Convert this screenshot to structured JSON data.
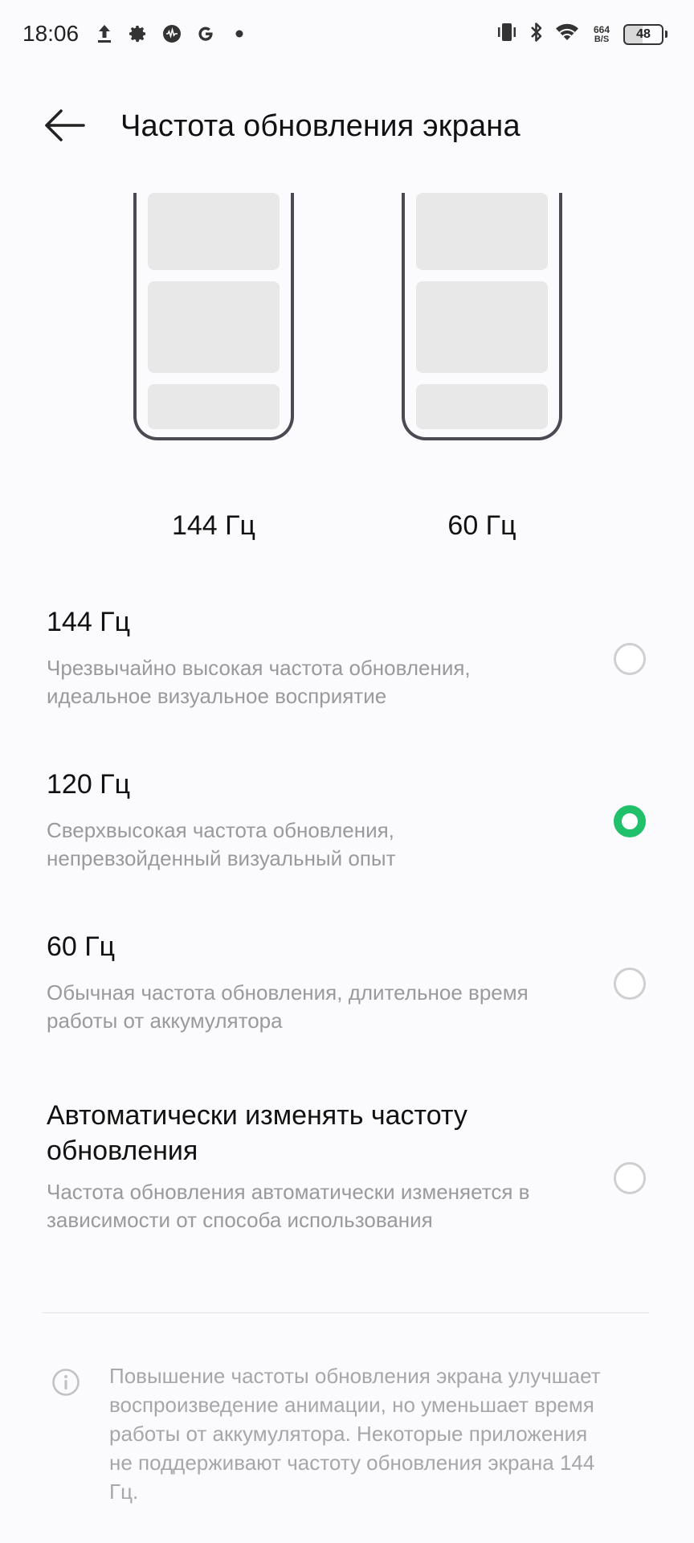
{
  "status_bar": {
    "time": "18:06",
    "left_icons": [
      "upload-icon",
      "gear-icon",
      "podcast-icon",
      "google-icon",
      "dot-icon"
    ],
    "right_icons": [
      "vibrate-icon",
      "bluetooth-icon",
      "wifi-icon"
    ],
    "net_speed_value": "664",
    "net_speed_unit": "B/S",
    "battery_level": "48"
  },
  "header": {
    "title": "Частота обновления экрана"
  },
  "preview": {
    "left_label": "144 Гц",
    "right_label": "60 Гц"
  },
  "options": [
    {
      "title": "144 Гц",
      "description": "Чрезвычайно высокая частота обновления, идеальное визуальное восприятие",
      "selected": false
    },
    {
      "title": "120 Гц",
      "description": "Сверхвысокая частота обновления, непревзойденный визуальный опыт",
      "selected": true
    },
    {
      "title": "60 Гц",
      "description": "Обычная частота обновления, длительное время работы от аккумулятора",
      "selected": false
    },
    {
      "title": "Автоматически изменять частоту обновления",
      "description": "Частота обновления автоматически изменяется в зависимости от способа использования",
      "selected": false
    }
  ],
  "note": {
    "text": "Повышение частоты обновления экрана улучшает воспроизведение анимации, но уменьшает время работы от аккумулятора. Некоторые приложения не поддерживают частоту обновления экрана 144 Гц."
  },
  "colors": {
    "accent": "#21c16b",
    "background": "#fbfbfd",
    "secondary_text": "#9a9a9e"
  }
}
